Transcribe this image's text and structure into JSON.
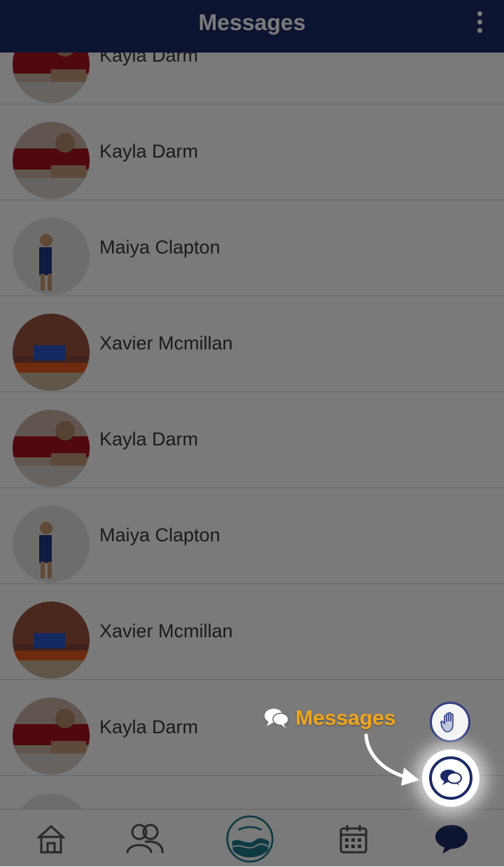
{
  "header": {
    "title": "Messages",
    "menu_icon": "kebab-menu-icon"
  },
  "conversations": [
    {
      "name": "Kayla Darm",
      "avatar": "kayla"
    },
    {
      "name": "Kayla Darm",
      "avatar": "kayla"
    },
    {
      "name": "Maiya Clapton",
      "avatar": "maiya"
    },
    {
      "name": "Xavier Mcmillan",
      "avatar": "xavier"
    },
    {
      "name": "Kayla Darm",
      "avatar": "kayla"
    },
    {
      "name": "Maiya Clapton",
      "avatar": "maiya"
    },
    {
      "name": "Xavier Mcmillan",
      "avatar": "xavier"
    },
    {
      "name": "Kayla Darm",
      "avatar": "kayla"
    },
    {
      "name": "",
      "avatar": "maiya"
    }
  ],
  "tabbar": {
    "tabs": [
      {
        "icon": "home-icon"
      },
      {
        "icon": "people-icon"
      },
      {
        "icon": "logo-icon"
      },
      {
        "icon": "calendar-icon"
      },
      {
        "icon": "chat-bubble-icon",
        "active": true
      }
    ]
  },
  "tutorial": {
    "label": "Messages",
    "label_icon": "chat-bubbles-icon",
    "label_color": "#f2a51a"
  },
  "colors": {
    "primary": "#1b2a66",
    "accent": "#f2a51a"
  }
}
